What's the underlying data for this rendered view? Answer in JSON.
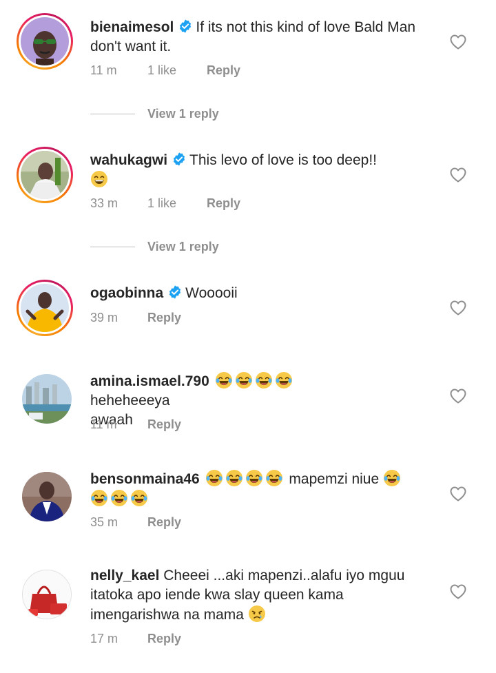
{
  "comments": [
    {
      "username": "bienaimesol",
      "verified": true,
      "text": "If its not this kind of love Bald Man don't want it.",
      "time": "11 m",
      "likes": "1 like",
      "reply": "Reply",
      "view_replies": "View 1 reply"
    },
    {
      "username": "wahukagwi",
      "verified": true,
      "text": "This levo of love is too deep!!",
      "time": "33 m",
      "likes": "1 like",
      "reply": "Reply",
      "view_replies": "View 1 reply"
    },
    {
      "username": "ogaobinna",
      "verified": true,
      "text": "Wooooii",
      "time": "39 m",
      "reply": "Reply"
    },
    {
      "username": "amina.ismael.790",
      "text": "heheheeeya awaah",
      "time": "11 m",
      "reply": "Reply"
    },
    {
      "username": "bensonmaina46",
      "text": "mapemzi niue",
      "time": "35 m",
      "reply": "Reply"
    },
    {
      "username": "nelly_kael",
      "text": "Cheeei ...aki mapenzi..alafu iyo mguu itatoka apo iende kwa slay queen kama imengarishwa na mama",
      "time": "17 m",
      "reply": "Reply"
    }
  ],
  "icons": {
    "verified": "verified-badge-icon",
    "like": "heart-outline-icon",
    "laugh": "face-with-tears-of-joy-emoji",
    "grin": "grinning-face-emoji",
    "cry": "crying-face-emoji"
  },
  "colors": {
    "text": "#262626",
    "secondary": "#8e8e8e",
    "verified": "#1da1f2",
    "story_ring_start": "#f9a825",
    "story_ring_end": "#c2185b"
  }
}
